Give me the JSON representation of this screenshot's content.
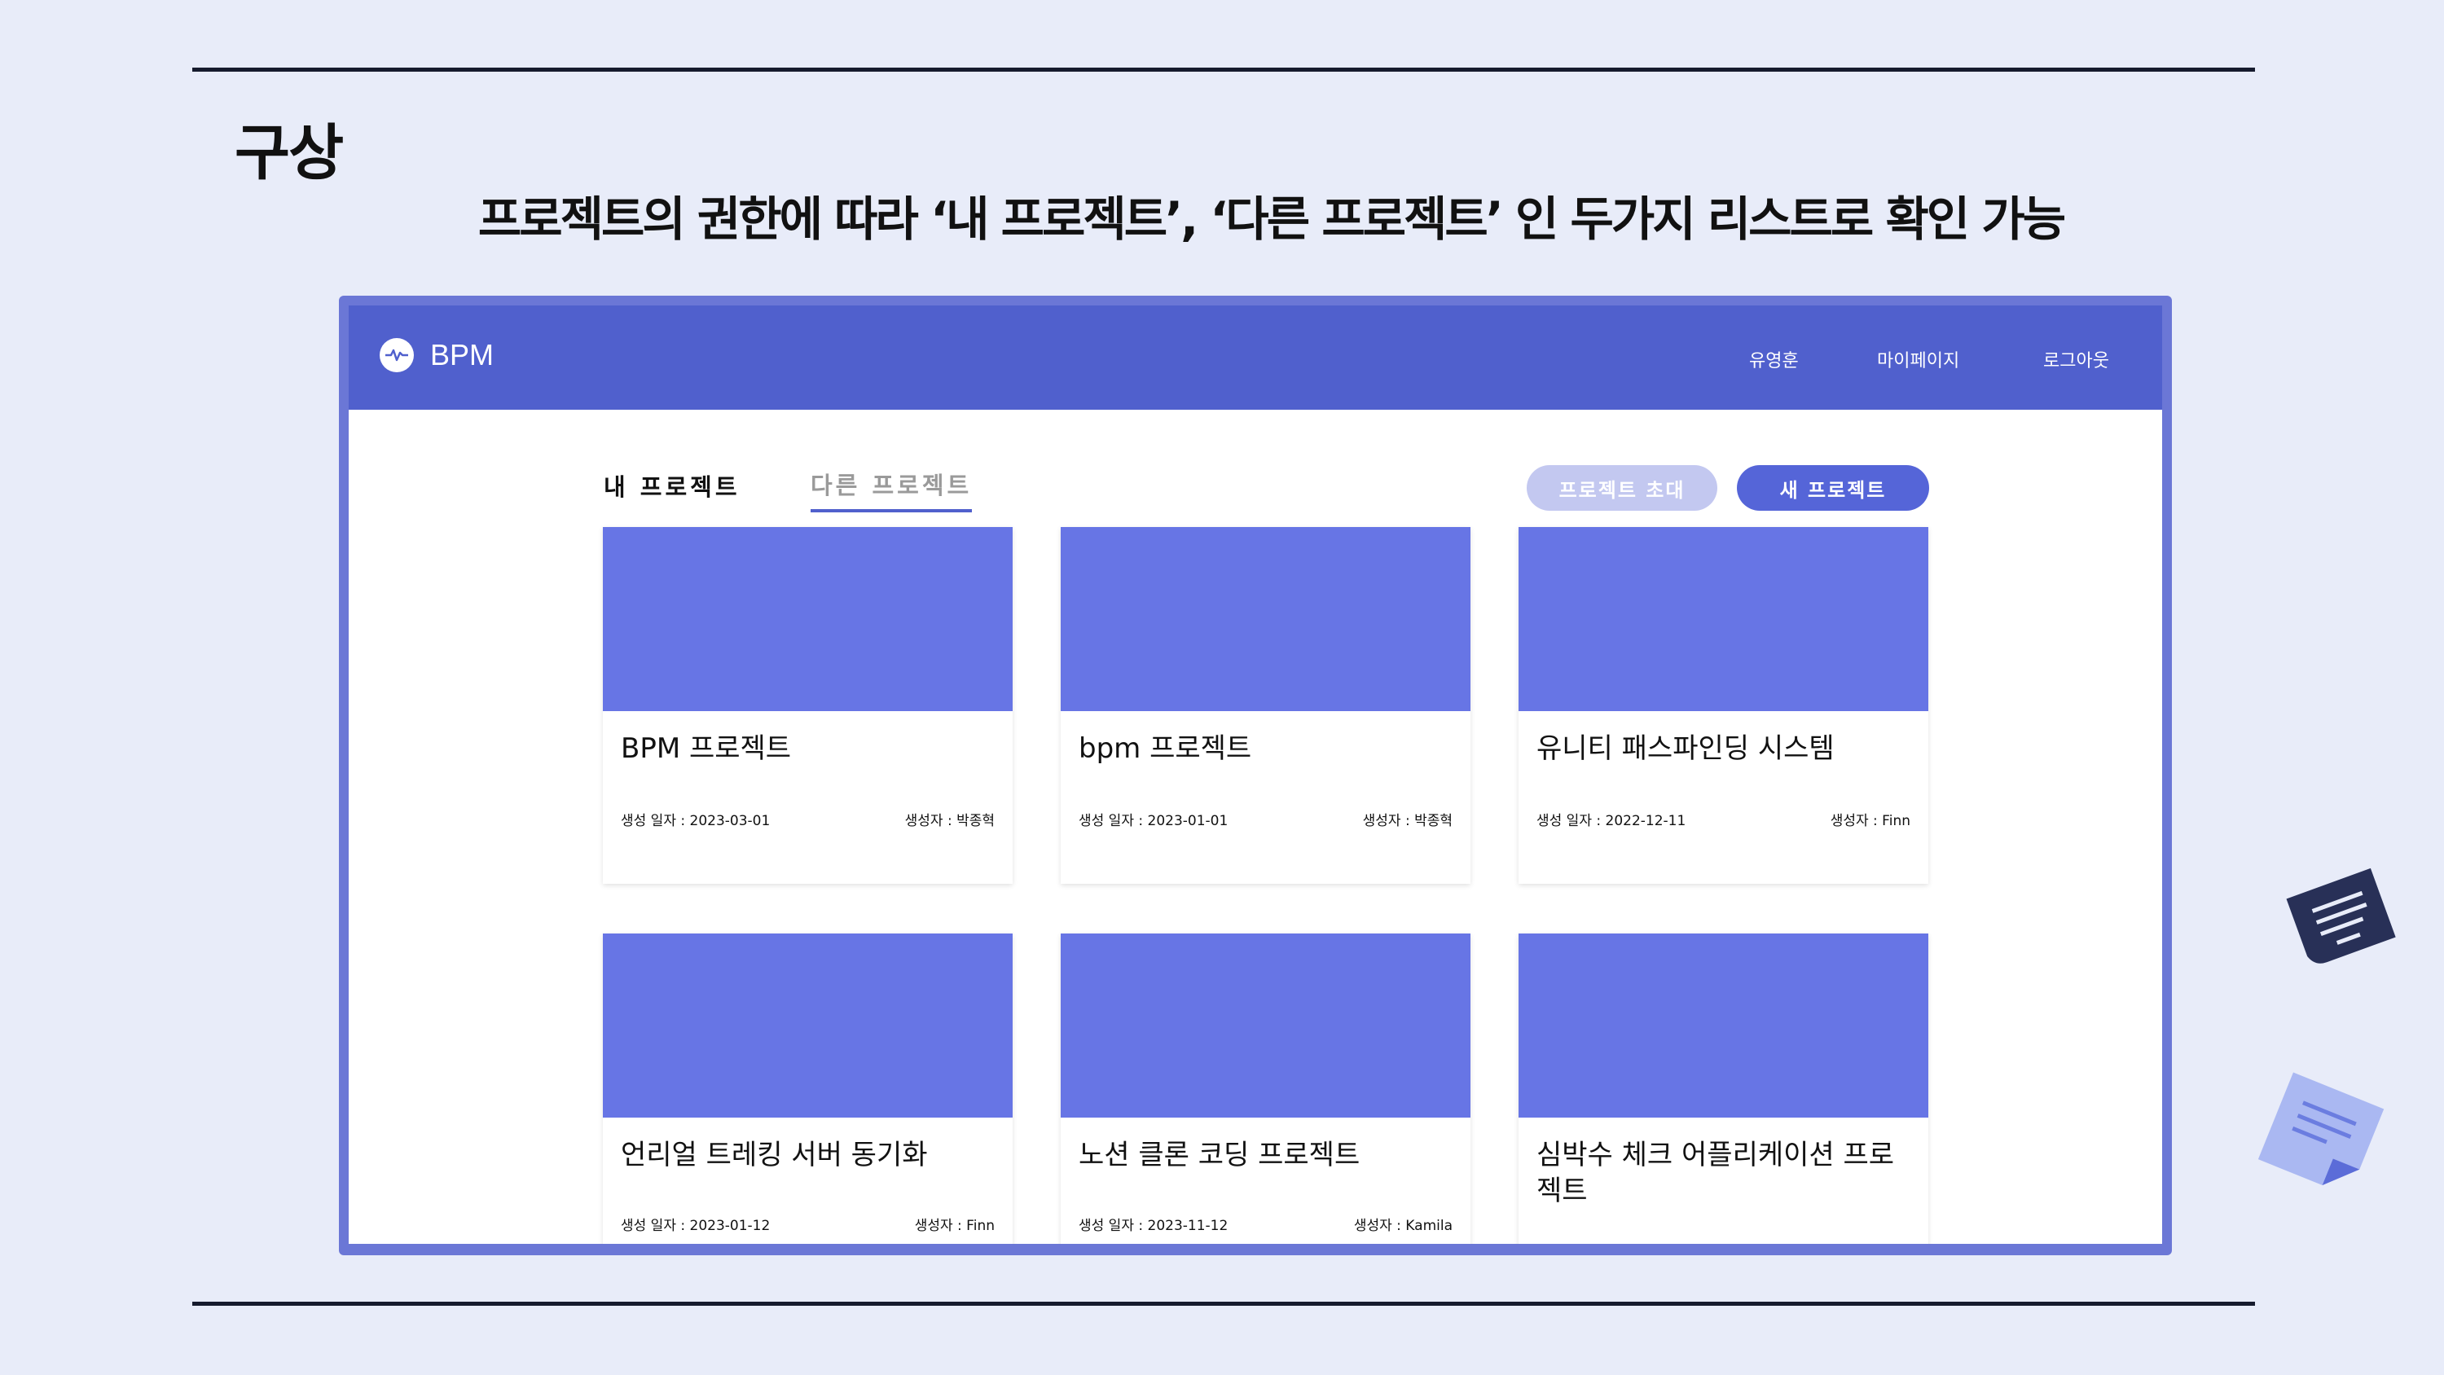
{
  "slide": {
    "title": "구상",
    "subtitle": "프로젝트의 권한에 따라 ‘내 프로젝트’, ‘다른 프로젝트’ 인 두가지 리스트로 확인 가능"
  },
  "app": {
    "brand": "BPM",
    "nav": {
      "user": "유영훈",
      "mypage": "마이페이지",
      "logout": "로그아웃"
    },
    "tabs": {
      "mine": "내 프로젝트",
      "other": "다른 프로젝트"
    },
    "buttons": {
      "invite": "프로젝트 초대",
      "new": "새 프로젝트"
    },
    "cards": [
      {
        "title": "BPM 프로젝트",
        "date": "생성 일자 : 2023-03-01",
        "creator": "생성자 : 박종혁"
      },
      {
        "title": "bpm 프로젝트",
        "date": "생성 일자 : 2023-01-01",
        "creator": "생성자 : 박종혁"
      },
      {
        "title": "유니티 패스파인딩 시스템",
        "date": "생성 일자 : 2022-12-11",
        "creator": "생성자 : Finn"
      },
      {
        "title": "언리얼 트레킹 서버 동기화",
        "date": "생성 일자 : 2023-01-12",
        "creator": "생성자 : Finn"
      },
      {
        "title": "노션 클론 코딩 프로젝트",
        "date": "생성 일자 : 2023-11-12",
        "creator": "생성자 : Kamila"
      },
      {
        "title": "심박수 체크 어플리케이션 프로젝트",
        "date": "",
        "creator": ""
      }
    ],
    "colors": {
      "navbar": "#5060cd",
      "thumb": "#6775e5",
      "accent": "#5565d8"
    }
  },
  "icons": {
    "logo": "heartbeat-icon",
    "deco1": "document-icon",
    "deco2": "note-icon"
  }
}
